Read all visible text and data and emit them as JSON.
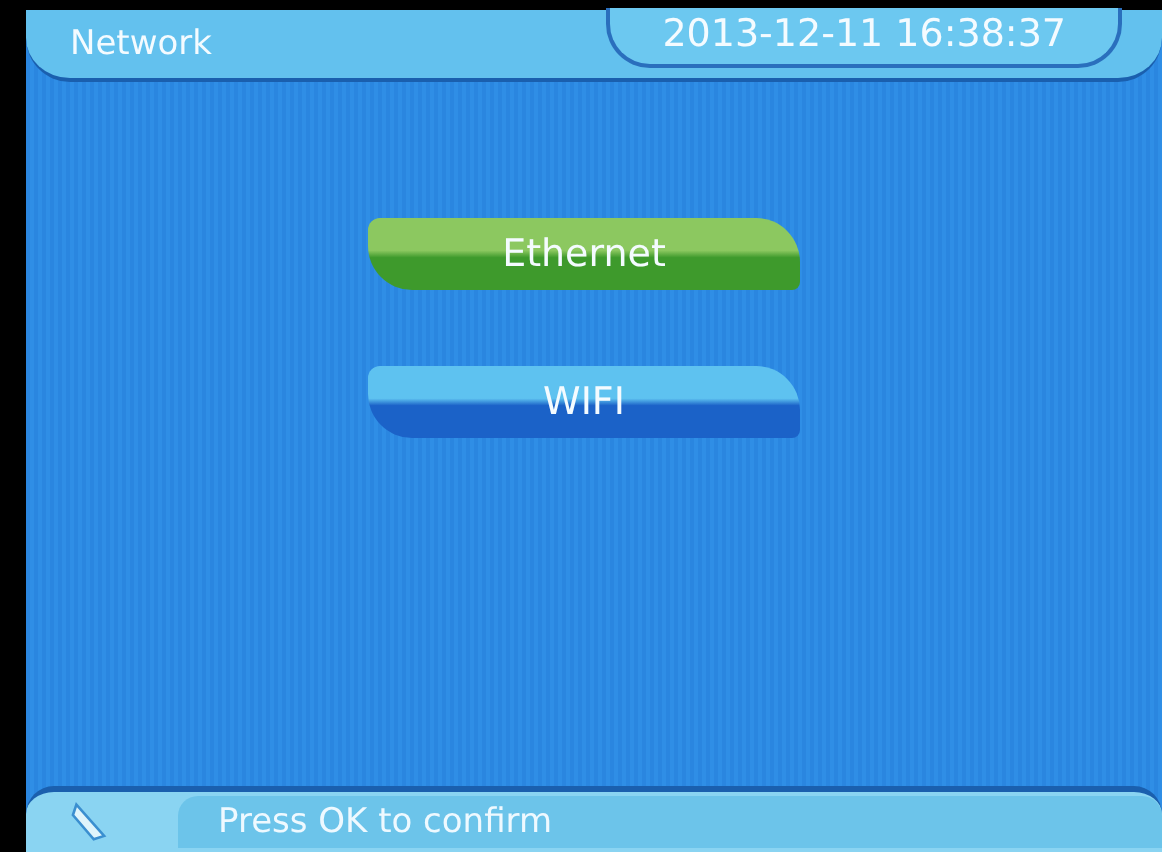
{
  "header": {
    "title": "Network",
    "datetime": "2013-12-11 16:38:37"
  },
  "menu": [
    {
      "label": "Ethernet",
      "selected": true
    },
    {
      "label": "WIFI",
      "selected": false
    }
  ],
  "footer": {
    "hint": "Press OK to confirm"
  }
}
